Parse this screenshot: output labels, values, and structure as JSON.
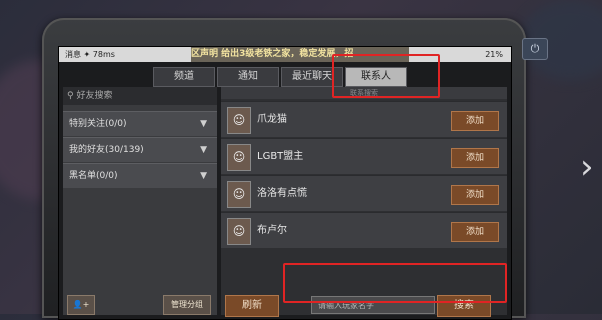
{
  "statusbar": {
    "left": "消息 ✦ 78ms",
    "announcement": "区声明 给出3级老铁之家，稳定发展，招",
    "battery": "21%"
  },
  "tabs": [
    "频道",
    "通知",
    "最近聊天",
    "联系人"
  ],
  "active_tab": "联系人",
  "search_placeholder": "好友搜索",
  "groups": [
    {
      "label": "特别关注(0/0)"
    },
    {
      "label": "我的好友(30/139)"
    },
    {
      "label": "黑名单(0/0)"
    }
  ],
  "left_bottom": {
    "manage_label": "管理分组"
  },
  "right_header": "联系搜索",
  "contacts": [
    {
      "name": "爪龙猫",
      "action": "添加"
    },
    {
      "name": "LGBT盟主",
      "action": "添加"
    },
    {
      "name": "洛洛有点慌",
      "action": "添加"
    },
    {
      "name": "布卢尔",
      "action": "添加"
    }
  ],
  "bottom": {
    "refresh_label": "刷新",
    "input_placeholder": "请输入玩家名字",
    "search_label": "搜索"
  },
  "icons": {
    "power": "power-icon",
    "search": "search-icon",
    "chevron": "chevron-down-icon",
    "add_friend": "add-friend-icon",
    "next": "chevron-right-icon"
  },
  "colors": {
    "highlight": "#e02424",
    "action_button": "#7a4a28",
    "active_tab": "#b8b8b8"
  }
}
